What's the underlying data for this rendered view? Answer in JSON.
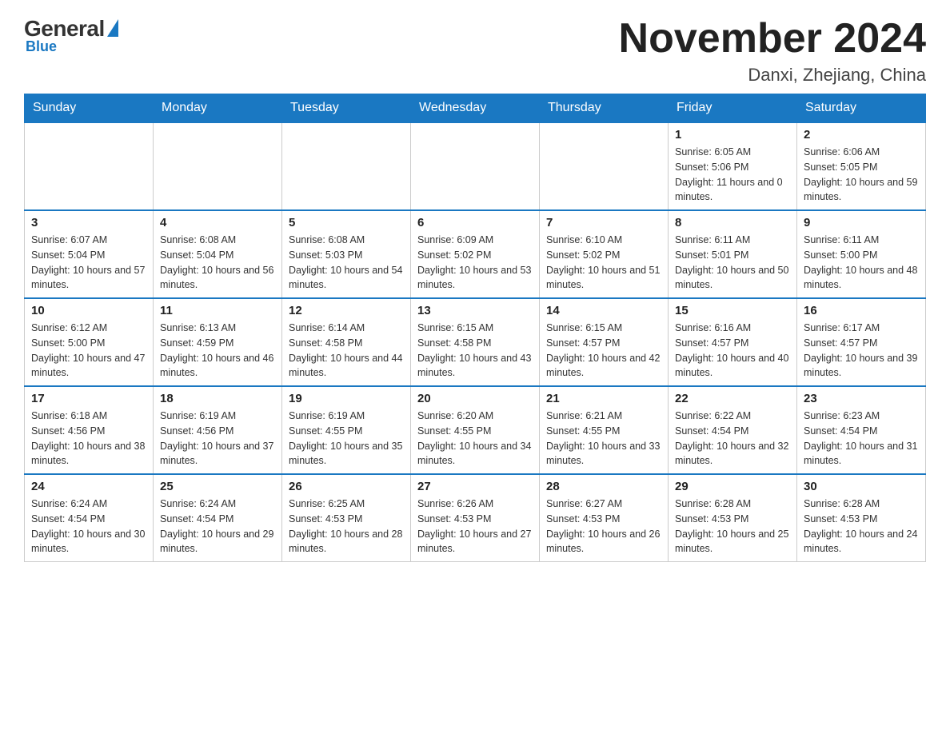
{
  "logo": {
    "general": "General",
    "blue": "Blue",
    "subtitle": "Blue"
  },
  "title": {
    "month_year": "November 2024",
    "location": "Danxi, Zhejiang, China"
  },
  "weekdays": [
    "Sunday",
    "Monday",
    "Tuesday",
    "Wednesday",
    "Thursday",
    "Friday",
    "Saturday"
  ],
  "weeks": [
    [
      {
        "day": "",
        "info": ""
      },
      {
        "day": "",
        "info": ""
      },
      {
        "day": "",
        "info": ""
      },
      {
        "day": "",
        "info": ""
      },
      {
        "day": "",
        "info": ""
      },
      {
        "day": "1",
        "info": "Sunrise: 6:05 AM\nSunset: 5:06 PM\nDaylight: 11 hours and 0 minutes."
      },
      {
        "day": "2",
        "info": "Sunrise: 6:06 AM\nSunset: 5:05 PM\nDaylight: 10 hours and 59 minutes."
      }
    ],
    [
      {
        "day": "3",
        "info": "Sunrise: 6:07 AM\nSunset: 5:04 PM\nDaylight: 10 hours and 57 minutes."
      },
      {
        "day": "4",
        "info": "Sunrise: 6:08 AM\nSunset: 5:04 PM\nDaylight: 10 hours and 56 minutes."
      },
      {
        "day": "5",
        "info": "Sunrise: 6:08 AM\nSunset: 5:03 PM\nDaylight: 10 hours and 54 minutes."
      },
      {
        "day": "6",
        "info": "Sunrise: 6:09 AM\nSunset: 5:02 PM\nDaylight: 10 hours and 53 minutes."
      },
      {
        "day": "7",
        "info": "Sunrise: 6:10 AM\nSunset: 5:02 PM\nDaylight: 10 hours and 51 minutes."
      },
      {
        "day": "8",
        "info": "Sunrise: 6:11 AM\nSunset: 5:01 PM\nDaylight: 10 hours and 50 minutes."
      },
      {
        "day": "9",
        "info": "Sunrise: 6:11 AM\nSunset: 5:00 PM\nDaylight: 10 hours and 48 minutes."
      }
    ],
    [
      {
        "day": "10",
        "info": "Sunrise: 6:12 AM\nSunset: 5:00 PM\nDaylight: 10 hours and 47 minutes."
      },
      {
        "day": "11",
        "info": "Sunrise: 6:13 AM\nSunset: 4:59 PM\nDaylight: 10 hours and 46 minutes."
      },
      {
        "day": "12",
        "info": "Sunrise: 6:14 AM\nSunset: 4:58 PM\nDaylight: 10 hours and 44 minutes."
      },
      {
        "day": "13",
        "info": "Sunrise: 6:15 AM\nSunset: 4:58 PM\nDaylight: 10 hours and 43 minutes."
      },
      {
        "day": "14",
        "info": "Sunrise: 6:15 AM\nSunset: 4:57 PM\nDaylight: 10 hours and 42 minutes."
      },
      {
        "day": "15",
        "info": "Sunrise: 6:16 AM\nSunset: 4:57 PM\nDaylight: 10 hours and 40 minutes."
      },
      {
        "day": "16",
        "info": "Sunrise: 6:17 AM\nSunset: 4:57 PM\nDaylight: 10 hours and 39 minutes."
      }
    ],
    [
      {
        "day": "17",
        "info": "Sunrise: 6:18 AM\nSunset: 4:56 PM\nDaylight: 10 hours and 38 minutes."
      },
      {
        "day": "18",
        "info": "Sunrise: 6:19 AM\nSunset: 4:56 PM\nDaylight: 10 hours and 37 minutes."
      },
      {
        "day": "19",
        "info": "Sunrise: 6:19 AM\nSunset: 4:55 PM\nDaylight: 10 hours and 35 minutes."
      },
      {
        "day": "20",
        "info": "Sunrise: 6:20 AM\nSunset: 4:55 PM\nDaylight: 10 hours and 34 minutes."
      },
      {
        "day": "21",
        "info": "Sunrise: 6:21 AM\nSunset: 4:55 PM\nDaylight: 10 hours and 33 minutes."
      },
      {
        "day": "22",
        "info": "Sunrise: 6:22 AM\nSunset: 4:54 PM\nDaylight: 10 hours and 32 minutes."
      },
      {
        "day": "23",
        "info": "Sunrise: 6:23 AM\nSunset: 4:54 PM\nDaylight: 10 hours and 31 minutes."
      }
    ],
    [
      {
        "day": "24",
        "info": "Sunrise: 6:24 AM\nSunset: 4:54 PM\nDaylight: 10 hours and 30 minutes."
      },
      {
        "day": "25",
        "info": "Sunrise: 6:24 AM\nSunset: 4:54 PM\nDaylight: 10 hours and 29 minutes."
      },
      {
        "day": "26",
        "info": "Sunrise: 6:25 AM\nSunset: 4:53 PM\nDaylight: 10 hours and 28 minutes."
      },
      {
        "day": "27",
        "info": "Sunrise: 6:26 AM\nSunset: 4:53 PM\nDaylight: 10 hours and 27 minutes."
      },
      {
        "day": "28",
        "info": "Sunrise: 6:27 AM\nSunset: 4:53 PM\nDaylight: 10 hours and 26 minutes."
      },
      {
        "day": "29",
        "info": "Sunrise: 6:28 AM\nSunset: 4:53 PM\nDaylight: 10 hours and 25 minutes."
      },
      {
        "day": "30",
        "info": "Sunrise: 6:28 AM\nSunset: 4:53 PM\nDaylight: 10 hours and 24 minutes."
      }
    ]
  ]
}
